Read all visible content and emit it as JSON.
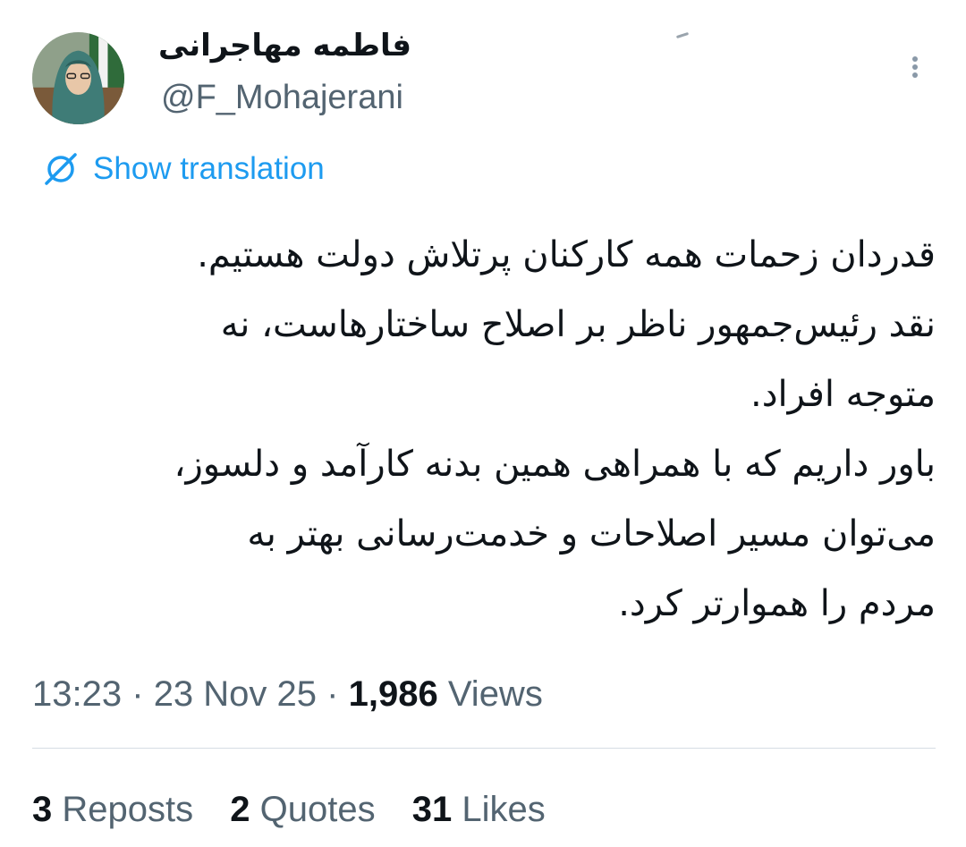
{
  "author": {
    "display_name": "فاطمه مهاجرانی",
    "handle": "@F_Mohajerani"
  },
  "translation": {
    "label": "Show translation",
    "icon": "translate-icon"
  },
  "tweet": {
    "lines": [
      "قدردان زحمات همه کارکنان پرتلاش دولت هستیم.",
      "نقد رئیس‌جمهور ناظر بر اصلاح ساختارهاست، نه",
      "متوجه افراد.",
      "باور داریم که با همراهی همین بدنه کارآمد و دلسوز،",
      "می‌توان مسیر اصلاحات و خدمت‌رسانی بهتر به",
      "مردم را هموارتر کرد."
    ]
  },
  "meta": {
    "time": "13:23",
    "separator": "·",
    "date": "23 Nov 25",
    "views_count": "1,986",
    "views_label": "Views"
  },
  "stats": {
    "reposts_count": "3",
    "reposts_label": "Reposts",
    "quotes_count": "2",
    "quotes_label": "Quotes",
    "likes_count": "31",
    "likes_label": "Likes"
  },
  "colors": {
    "accent": "#1d9bf0",
    "secondary_text": "#536471",
    "primary_text": "#0f1419",
    "divider": "#d5dde3"
  }
}
